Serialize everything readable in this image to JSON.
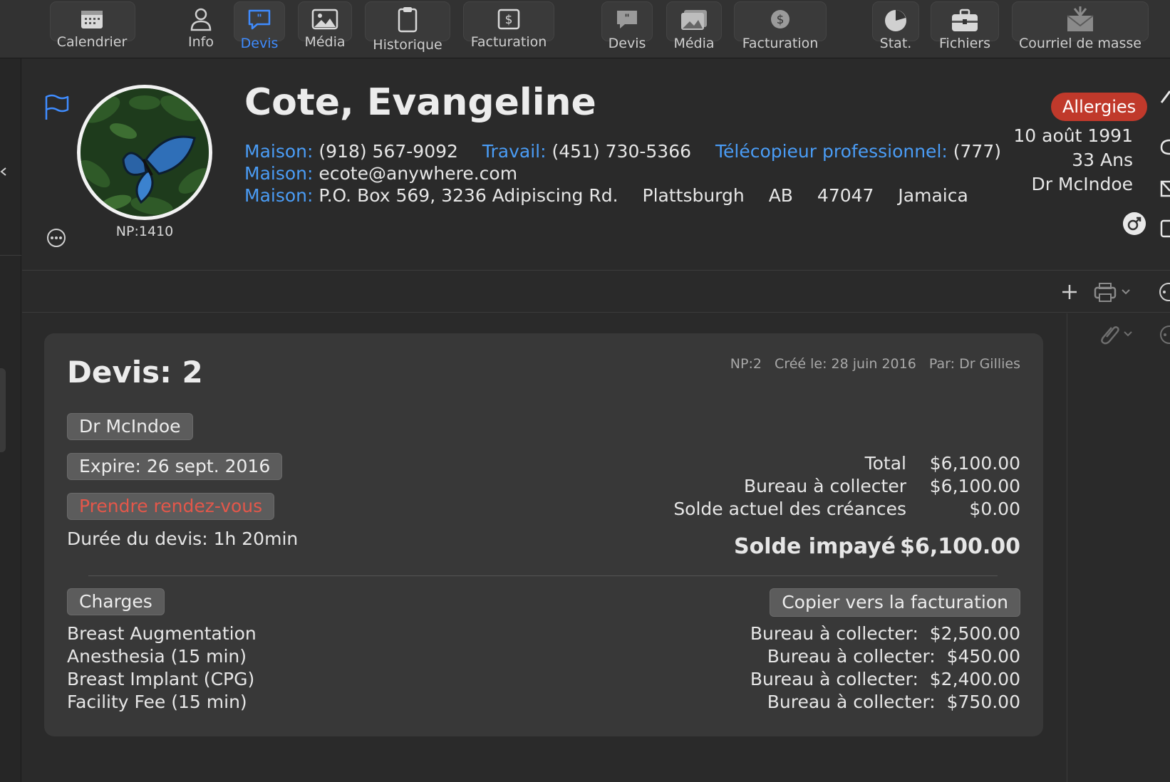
{
  "toolbar": {
    "items": [
      {
        "label": "Calendrier",
        "icon": "calendar-icon"
      },
      {
        "label": "Info",
        "icon": "person-icon"
      },
      {
        "label": "Devis",
        "icon": "quote-icon",
        "active": true
      },
      {
        "label": "Média",
        "icon": "image-icon"
      },
      {
        "label": "Historique",
        "icon": "clipboard-icon"
      },
      {
        "label": "Facturation",
        "icon": "dollar-icon"
      },
      {
        "label": "Devis",
        "icon": "quote-icon"
      },
      {
        "label": "Média",
        "icon": "image-icon"
      },
      {
        "label": "Facturation",
        "icon": "dollar-icon"
      },
      {
        "label": "Stat.",
        "icon": "pie-chart-icon"
      },
      {
        "label": "Fichiers",
        "icon": "briefcase-icon"
      },
      {
        "label": "Courriel de masse",
        "icon": "mass-mail-icon"
      }
    ]
  },
  "patient": {
    "name": "Cote, Evangeline",
    "np": "NP:1410",
    "phone_home_label": "Maison:",
    "phone_home": "(918) 567-9092",
    "phone_work_label": "Travail:",
    "phone_work": "(451) 730-5366",
    "fax_label": "Télécopieur professionnel:",
    "fax": "(777)",
    "email_label": "Maison:",
    "email": "ecote@anywhere.com",
    "address_label": "Maison:",
    "street": "P.O. Box 569, 3236 Adipiscing Rd.",
    "city": "Plattsburgh",
    "province": "AB",
    "postal": "47047",
    "country": "Jamaica",
    "allergies_label": "Allergies",
    "dob": "10 août 1991",
    "age": "33 Ans",
    "doctor": "Dr McIndoe"
  },
  "quote": {
    "title": "Devis: 2",
    "meta": "NP:2   Créé le: 28 juin 2016   Par: Dr Gillies",
    "doctor_pill": "Dr McIndoe",
    "expire_pill": "Expire: 26 sept. 2016",
    "appointment_pill": "Prendre rendez-vous",
    "duration": "Durée du devis: 1h 20min",
    "totals": [
      {
        "label": "Total",
        "value": "$6,100.00"
      },
      {
        "label": "Bureau à collecter",
        "value": "$6,100.00"
      },
      {
        "label": "Solde actuel des créances",
        "value": "$0.00"
      }
    ],
    "balance_label": "Solde impayé",
    "balance_value": "$6,100.00",
    "charges_pill": "Charges",
    "copy_button": "Copier vers la facturation",
    "charges": [
      {
        "name": "Breast Augmentation",
        "amount": "Bureau à collecter:  $2,500.00"
      },
      {
        "name": "Anesthesia (15 min)",
        "amount": "Bureau à collecter:  $450.00"
      },
      {
        "name": "Breast Implant (CPG)",
        "amount": "Bureau à collecter:  $2,400.00"
      },
      {
        "name": "Facility Fee (15 min)",
        "amount": "Bureau à collecter:  $750.00"
      }
    ]
  },
  "colors": {
    "accent": "#3f8cff",
    "link_label": "#4a9cf5",
    "allergy": "#c0392b",
    "appointment_text": "#e4574a"
  }
}
